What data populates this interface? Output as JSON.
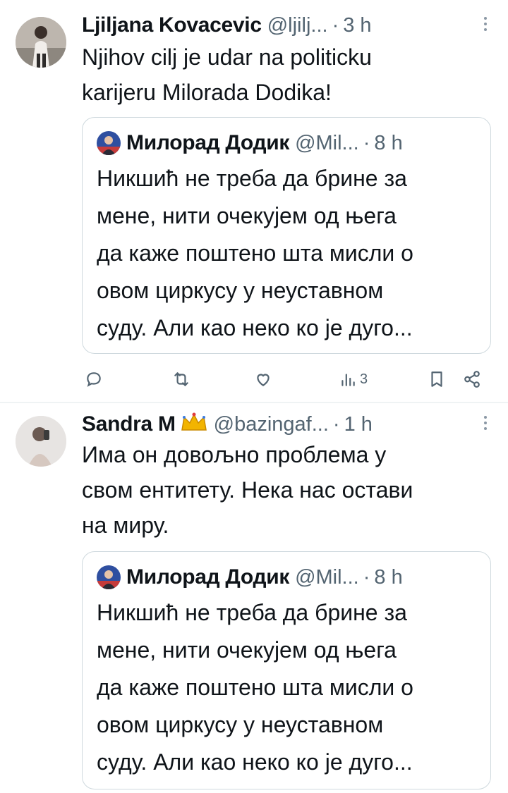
{
  "tweets": [
    {
      "author": {
        "name": "Ljiljana Kovacevic",
        "handle": "@ljilj...",
        "time": "3 h",
        "separator": "·",
        "avatar_icon": "user-photo-avatar"
      },
      "text": "Njihov cilj je udar na politicku\nkarijeru Milorada Dodika!",
      "more_icon": "more-vertical-icon",
      "quote": {
        "name": "Милорад Додик",
        "handle": "@Mil...",
        "time": "8 h",
        "separator": "·",
        "text": "Никшић не треба да брине за\nмене, нити очекујем од њега\nда каже поштено шта мисли о\nовом циркусу у неуставном\nсуду. Али као неко ко је дуго..."
      },
      "actions": {
        "reply_icon": "reply-icon",
        "retweet_icon": "retweet-icon",
        "like_icon": "like-icon",
        "views_icon": "views-icon",
        "views_count": "3",
        "bookmark_icon": "bookmark-icon",
        "share_icon": "share-icon"
      }
    },
    {
      "author": {
        "name": "Sandra M",
        "badge_icon": "crown-icon",
        "handle": "@bazingaf...",
        "time": "1 h",
        "separator": "·",
        "avatar_icon": "user-photo-avatar"
      },
      "text": "Има он довољно проблема у\nсвом ентитету. Нека нас остави\nна миру.",
      "more_icon": "more-vertical-icon",
      "quote": {
        "name": "Милорад Додик",
        "handle": "@Mil...",
        "time": "8 h",
        "separator": "·",
        "text": "Никшић не треба да брине за\nмене, нити очекујем од њега\nда каже поштено шта мисли о\nовом циркусу у неуставном\nсуду. Али као неко ко је дуго..."
      }
    }
  ],
  "colors": {
    "text_primary": "#0f1419",
    "text_secondary": "#536471",
    "border": "#cfd9de",
    "divider": "#eff3f4",
    "crown": "#e8a300"
  }
}
